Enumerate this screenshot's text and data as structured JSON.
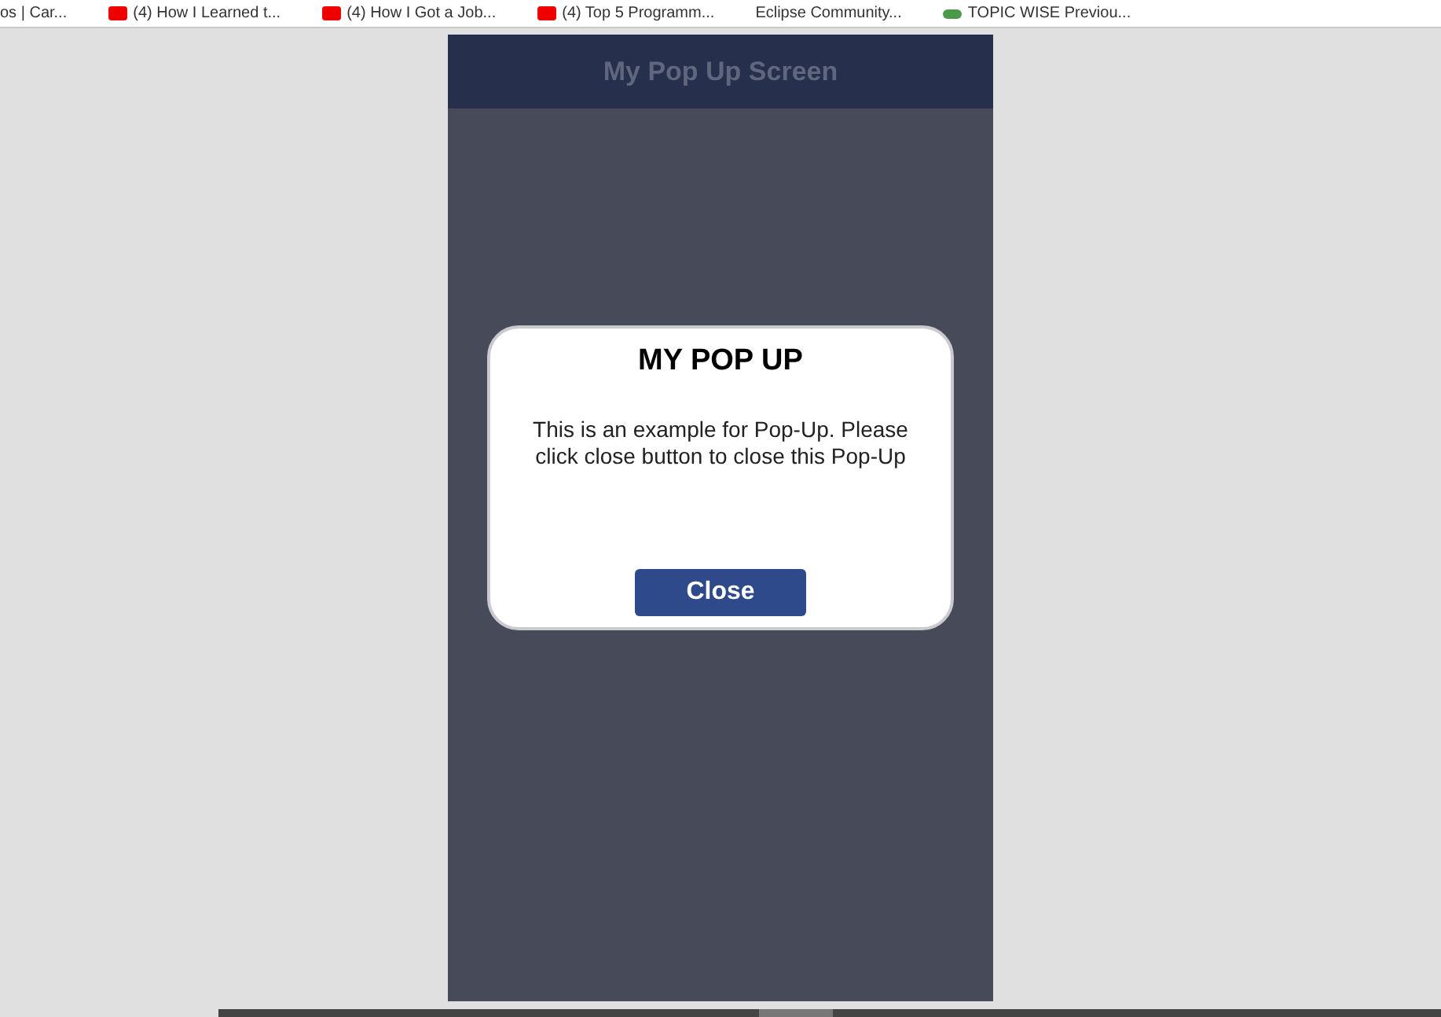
{
  "bookmarks": [
    {
      "label": "os | Car..."
    },
    {
      "label": "(4) How I Learned t..."
    },
    {
      "label": "(4) How I Got a Job..."
    },
    {
      "label": "(4) Top 5 Programm..."
    },
    {
      "label": "Eclipse Community..."
    },
    {
      "label": "TOPIC WISE Previou..."
    }
  ],
  "screen": {
    "title": "My Pop Up Screen"
  },
  "popup": {
    "title": "MY POP UP",
    "message": "This is an example for Pop-Up. Please click close button to close this Pop-Up",
    "button": "Close"
  }
}
